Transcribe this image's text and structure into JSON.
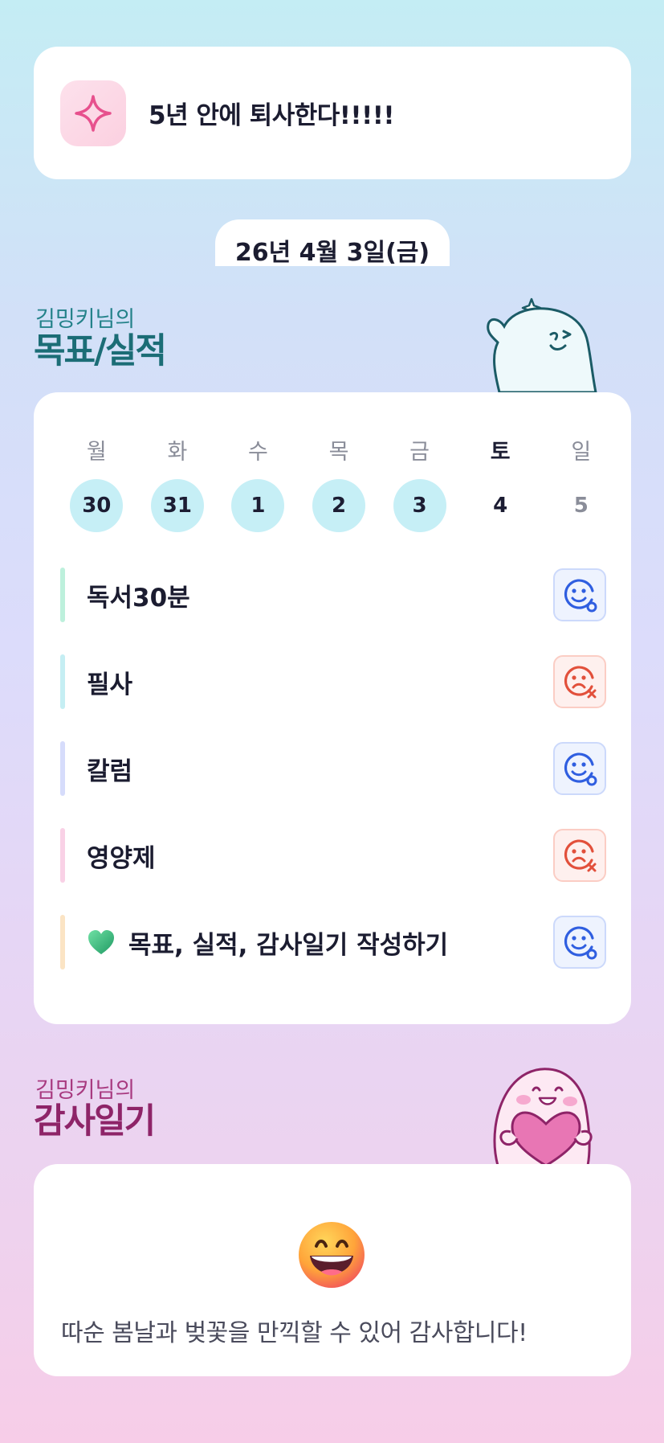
{
  "goal": {
    "text": "5년 안에 퇴사한다!!!!!",
    "icon": "sparkle-icon"
  },
  "date": "26년 4월 3일(금)",
  "goals_section": {
    "owner": "김밍키님의",
    "title": "목표/실적",
    "mascot": "waving-ghost-mascot"
  },
  "week": {
    "days": [
      {
        "label": "월",
        "num": "30",
        "done": true
      },
      {
        "label": "화",
        "num": "31",
        "done": true
      },
      {
        "label": "수",
        "num": "1",
        "done": true
      },
      {
        "label": "목",
        "num": "2",
        "done": true
      },
      {
        "label": "금",
        "num": "3",
        "done": true
      },
      {
        "label": "토",
        "num": "4",
        "done": false
      },
      {
        "label": "일",
        "num": "5",
        "done": false
      }
    ]
  },
  "tasks": [
    {
      "label": "독서30분",
      "status": "success",
      "bar_color": "#bdf0dc"
    },
    {
      "label": "필사",
      "status": "fail",
      "bar_color": "#c5eef3"
    },
    {
      "label": "칼럼",
      "status": "success",
      "bar_color": "#d6dcfb"
    },
    {
      "label": "영양제",
      "status": "fail",
      "bar_color": "#f9d1e6"
    },
    {
      "label": "목표, 실적, 감사일기 작성하기",
      "status": "success",
      "bar_color": "#fbe4c4",
      "icon": "green-heart-icon"
    }
  ],
  "gratitude_section": {
    "owner": "김밍키님의",
    "title": "감사일기",
    "mascot": "heart-hugging-mascot"
  },
  "gratitude": {
    "emoji": "grinning-face-icon",
    "text": "따순 봄날과 벚꽃을 만끽할 수 있어 감사합니다!"
  },
  "colors": {
    "success": "#2f5ee0",
    "fail": "#e2503b",
    "done_day": "#c6eff6"
  }
}
